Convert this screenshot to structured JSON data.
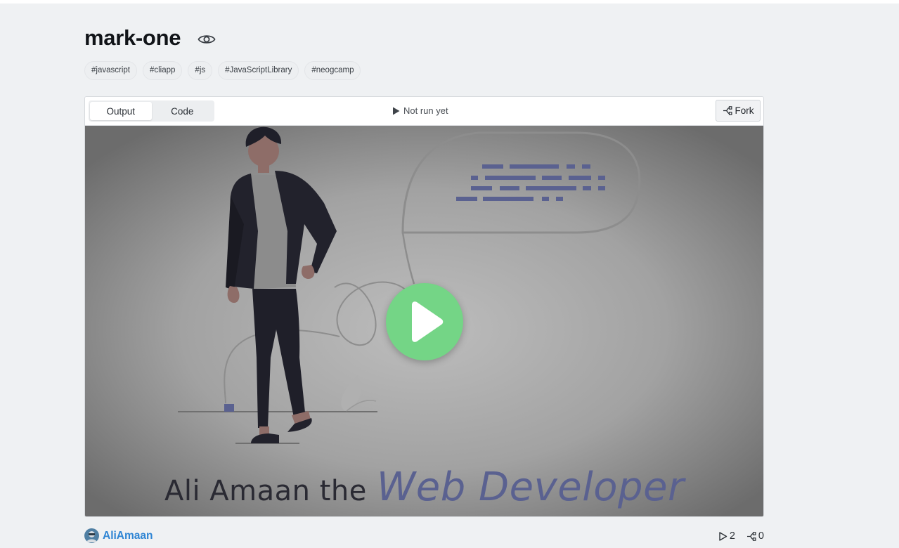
{
  "playground": {
    "title": "mark-one",
    "tags": [
      "#javascript",
      "#cliapp",
      "#js",
      "#JavaScriptLibrary",
      "#neogcamp"
    ]
  },
  "toolbar": {
    "tabs": [
      {
        "label": "Output",
        "active": true
      },
      {
        "label": "Code",
        "active": false
      }
    ],
    "run_status": "Not run yet",
    "fork_label": "Fork"
  },
  "preview": {
    "caption_part1": "Ali Amaan the",
    "caption_part2": "Web Developer"
  },
  "footer": {
    "author": "AliAmaan",
    "runs": "2",
    "forks": "0"
  },
  "colors": {
    "background": "#eff1f3",
    "accent_link": "#2f85d4",
    "play_button": "#74d586",
    "code_lines": "#5a6190"
  },
  "icons": {
    "visibility": "eye-icon",
    "run": "play-triangle-icon",
    "fork": "fork-icon",
    "big_play": "play-icon"
  }
}
